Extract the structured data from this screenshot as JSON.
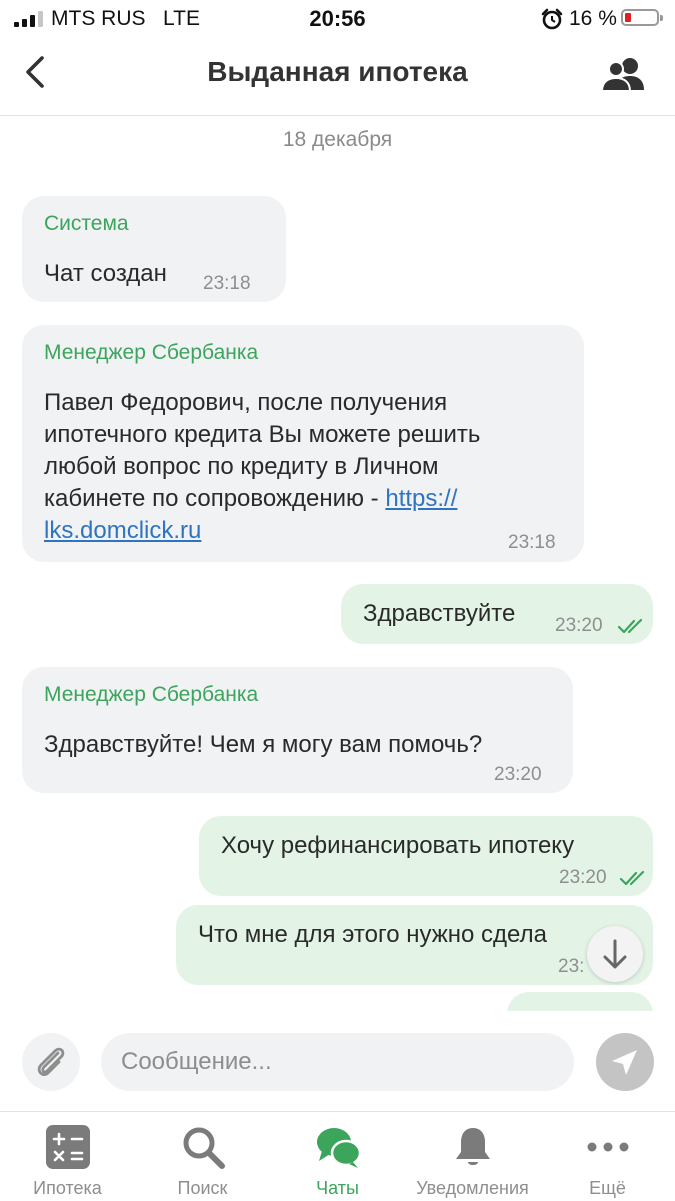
{
  "status_bar": {
    "carrier": "MTS RUS   LTE",
    "time": "20:56",
    "battery": "16 %"
  },
  "header": {
    "title": "Выданная ипотека"
  },
  "chat": {
    "date": "18 декабря",
    "messages": [
      {
        "direction": "in",
        "sender": "Система",
        "text": "Чат создан",
        "time": "23:18"
      },
      {
        "direction": "in",
        "sender": "Менеджер Сбербанка",
        "lines": [
          "Павел Федорович, после получения",
          "ипотечного кредита Вы можете решить",
          "любой вопрос по кредиту в Личном",
          "кабинете по сопровождению - "
        ],
        "link_part1": "https://",
        "link_part2": "lks.domclick.ru",
        "time": "23:18"
      },
      {
        "direction": "out",
        "text": "Здравствуйте",
        "time": "23:20",
        "status": "read"
      },
      {
        "direction": "in",
        "sender": "Менеджер Сбербанка",
        "text": "Здравствуйте! Чем я могу вам помочь?",
        "time": "23:20"
      },
      {
        "direction": "out",
        "text": "Хочу рефинансировать ипотеку",
        "time": "23:20",
        "status": "read"
      },
      {
        "direction": "out",
        "text": "Что мне для этого нужно сдела",
        "time": "23:",
        "status": "read"
      }
    ]
  },
  "composer": {
    "placeholder": "Сообщение..."
  },
  "tabs": [
    {
      "label": "Ипотека",
      "icon": "calculator-icon"
    },
    {
      "label": "Поиск",
      "icon": "search-icon"
    },
    {
      "label": "Чаты",
      "icon": "chat-icon",
      "active": true
    },
    {
      "label": "Уведомления",
      "icon": "bell-icon"
    },
    {
      "label": "Ещё",
      "icon": "more-icon"
    }
  ],
  "colors": {
    "accent": "#3ba55c",
    "incoming_bubble": "#f1f2f4",
    "outgoing_bubble": "#e3f4e6",
    "link": "#2f74c0"
  }
}
